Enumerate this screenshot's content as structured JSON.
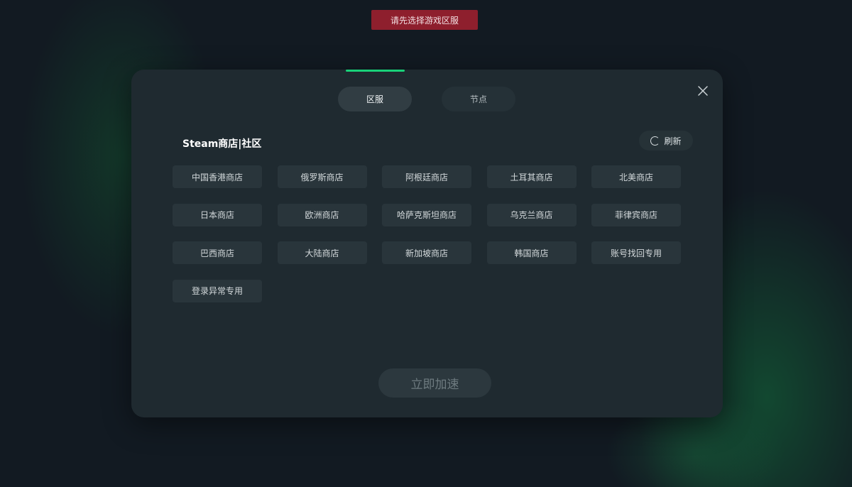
{
  "toast": {
    "message": "请先选择游戏区服"
  },
  "modal": {
    "tabs": [
      {
        "label": "区服",
        "active": true
      },
      {
        "label": "节点",
        "active": false
      }
    ],
    "close_icon": "close-icon",
    "section_title": "Steam商店|社区",
    "refresh": {
      "label": "刷新",
      "icon": "refresh-spinner-icon"
    },
    "servers": [
      "中国香港商店",
      "俄罗斯商店",
      "阿根廷商店",
      "土耳其商店",
      "北美商店",
      "日本商店",
      "欧洲商店",
      "哈萨克斯坦商店",
      "乌克兰商店",
      "菲律宾商店",
      "巴西商店",
      "大陆商店",
      "新加坡商店",
      "韩国商店",
      "账号找回专用",
      "登录异常专用"
    ],
    "accelerate_label": "立即加速"
  },
  "colors": {
    "accent": "#19d279",
    "toast_bg": "#8e1f2d",
    "modal_bg": "#1f2a30"
  }
}
